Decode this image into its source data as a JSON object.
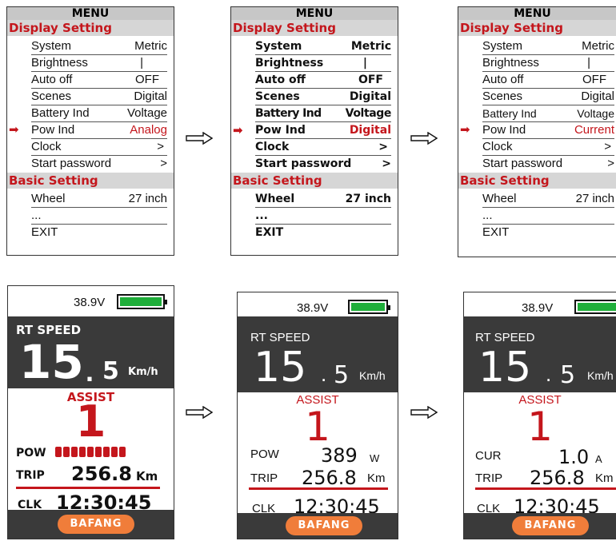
{
  "menu_screens": [
    {
      "title": "MENU",
      "display_section": "Display Setting",
      "rows": [
        {
          "label": "System",
          "value": "Metric"
        },
        {
          "label": "Brightness",
          "value": "|"
        },
        {
          "label": "Auto off",
          "value": "OFF"
        },
        {
          "label": "Scenes",
          "value": "Digital"
        },
        {
          "label": "Battery Ind",
          "value": "Voltage"
        },
        {
          "label": "Pow Ind",
          "value": "Analog"
        },
        {
          "label": "Clock",
          "value": ">"
        },
        {
          "label": "Start password",
          "value": ">"
        }
      ],
      "basic_section": "Basic Setting",
      "basic_rows": [
        {
          "label": "Wheel",
          "value": "27 inch"
        },
        {
          "label": "...",
          "value": ""
        },
        {
          "label": "EXIT",
          "value": ""
        }
      ]
    },
    {
      "title": "MENU",
      "display_section": "Display Setting",
      "rows": [
        {
          "label": "System",
          "value": "Metric"
        },
        {
          "label": "Brightness",
          "value": "|"
        },
        {
          "label": "Auto off",
          "value": "OFF"
        },
        {
          "label": "Scenes",
          "value": "Digital"
        },
        {
          "label": "Battery Ind",
          "value": "Voltage"
        },
        {
          "label": "Pow Ind",
          "value": "Digital"
        },
        {
          "label": "Clock",
          "value": ">"
        },
        {
          "label": "Start password",
          "value": ">"
        }
      ],
      "basic_section": "Basic Setting",
      "basic_rows": [
        {
          "label": "Wheel",
          "value": "27 inch"
        },
        {
          "label": "...",
          "value": ""
        },
        {
          "label": "EXIT",
          "value": ""
        }
      ]
    },
    {
      "title": "MENU",
      "display_section": "Display Setting",
      "rows": [
        {
          "label": "System",
          "value": "Metric"
        },
        {
          "label": "Brightness",
          "value": "|"
        },
        {
          "label": "Auto off",
          "value": "OFF"
        },
        {
          "label": "Scenes",
          "value": "Digital"
        },
        {
          "label": "Battery Ind",
          "value": "Voltage"
        },
        {
          "label": "Pow Ind",
          "value": "Current"
        },
        {
          "label": "Clock",
          "value": ">"
        },
        {
          "label": "Start password",
          "value": ">"
        }
      ],
      "basic_section": "Basic Setting",
      "basic_rows": [
        {
          "label": "Wheel",
          "value": "27 inch"
        },
        {
          "label": "...",
          "value": ""
        },
        {
          "label": "EXIT",
          "value": ""
        }
      ]
    }
  ],
  "selection_marker_icon": "right-arrow-icon",
  "flow_arrow_icon": "hollow-right-arrow-icon",
  "dash_screens": [
    {
      "voltage": "38.9V",
      "battery_level": 1.0,
      "rt_speed_label": "RT SPEED",
      "speed_int": "15",
      "speed_dot": ".",
      "speed_dec": "5",
      "speed_unit": "Km/h",
      "assist_label": "ASSIST",
      "assist_level": "1",
      "pow_label": "POW",
      "pow_bar_count": 9,
      "trip_label": "TRIP",
      "trip_value": "256.8",
      "trip_unit": "Km",
      "clk_label": "CLK",
      "clock": "12:30:45",
      "brand": "BAFANG"
    },
    {
      "voltage": "38.9V",
      "battery_level": 1.0,
      "rt_speed_label": "RT SPEED",
      "speed_int": "15",
      "speed_dot": ".",
      "speed_dec": "5",
      "speed_unit": "Km/h",
      "assist_label": "ASSIST",
      "assist_level": "1",
      "pow_label": "POW",
      "pow_value": "389",
      "pow_unit": "W",
      "trip_label": "TRIP",
      "trip_value": "256.8",
      "trip_unit": "Km",
      "clk_label": "CLK",
      "clock": "12:30:45",
      "brand": "BAFANG"
    },
    {
      "voltage": "38.9V",
      "battery_level": 1.0,
      "rt_speed_label": "RT SPEED",
      "speed_int": "15",
      "speed_dot": ".",
      "speed_dec": "5",
      "speed_unit": "Km/h",
      "assist_label": "ASSIST",
      "assist_level": "1",
      "cur_label": "CUR",
      "cur_value": "1.0",
      "cur_unit": "A",
      "trip_label": "TRIP",
      "trip_value": "256.8",
      "trip_unit": "Km",
      "clk_label": "CLK",
      "clock": "12:30:45",
      "brand": "BAFANG"
    }
  ],
  "colors": {
    "accent_red": "#c4161c",
    "header_gray": "#d6d6d6",
    "panel_dark": "#3a3a3a",
    "battery_green": "#1fae3a",
    "brand_orange": "#f07d3a"
  }
}
